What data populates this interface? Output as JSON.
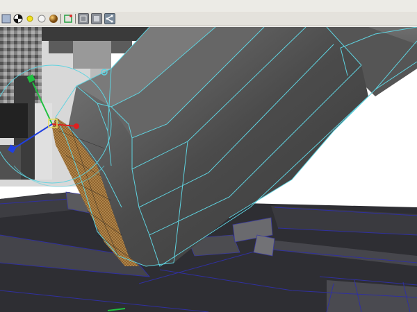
{
  "toolbar": {
    "buttons": [
      {
        "icon": "grid-display-icon"
      },
      {
        "icon": "checker-texture-icon"
      },
      {
        "icon": "default-light-icon"
      },
      {
        "icon": "all-lights-icon"
      },
      {
        "icon": "shaded-sphere-icon"
      },
      {
        "icon": "separator"
      },
      {
        "icon": "xray-icon"
      },
      {
        "icon": "separator"
      },
      {
        "icon": "wireframe-shaded-icon"
      },
      {
        "icon": "smooth-shaded-icon"
      },
      {
        "icon": "share-render-icon"
      }
    ]
  },
  "colors": {
    "wireframe": "#5fd3e0",
    "face_selection": "#a67a3a",
    "mesh_gray": "#5a5a5a",
    "floor_dark": "#2e2e33",
    "axis_x": "#e02020",
    "axis_y": "#20c040",
    "axis_z": "#2040e0",
    "manipulator_center": "#e8e060"
  }
}
